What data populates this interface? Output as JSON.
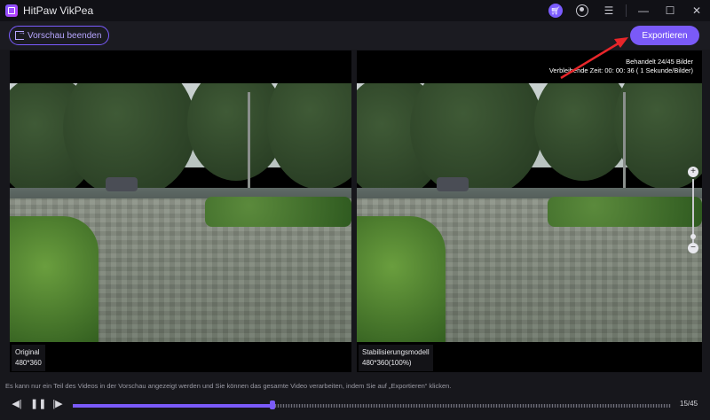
{
  "window": {
    "title": "HitPaw VikPea"
  },
  "titlebar": {
    "icons": [
      "cart-icon",
      "user-icon",
      "menu-icon",
      "minimize-icon",
      "maximize-icon",
      "close-icon"
    ]
  },
  "toolbar": {
    "exit_preview_label": "Vorschau beenden",
    "export_label": "Exportieren"
  },
  "progress_info": {
    "processed": "Behandelt 24/45 Bilder",
    "remaining": "Verbleibende Zeit: 00: 00: 36 ( 1 Sekunde/Bilder)"
  },
  "panels": {
    "original": {
      "name": "Original",
      "resolution": "480*360"
    },
    "processed": {
      "name": "Stabilisierungsmodell",
      "resolution": "480*360(100%)"
    }
  },
  "notice": "Es kann nur ein Teil des Videos in der Vorschau angezeigt werden und Sie können das gesamte Video verarbeiten, indem Sie auf „Exportieren“ klicken.",
  "player": {
    "frame_counter": "15/45",
    "current_frame": 15,
    "total_frames": 45
  },
  "colors": {
    "accent": "#7a5af8",
    "annotation_arrow": "#e8262a"
  }
}
